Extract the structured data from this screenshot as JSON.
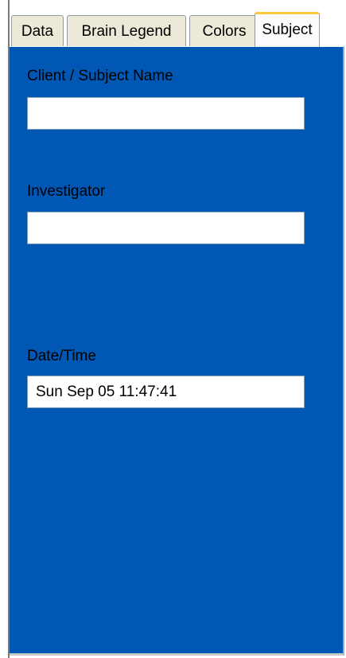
{
  "tabs": [
    {
      "label": "Data",
      "active": false
    },
    {
      "label": "Brain Legend",
      "active": false
    },
    {
      "label": "Colors",
      "active": false
    },
    {
      "label": "Subject",
      "active": true
    }
  ],
  "colors": {
    "panel_background": "#0058b4",
    "active_tab_highlight": "#ffc83c",
    "tab_background": "#ece9d8"
  },
  "fields": {
    "client_name": {
      "label": "Client / Subject Name",
      "value": ""
    },
    "investigator": {
      "label": "Investigator",
      "value": ""
    },
    "date_time": {
      "label": "Date/Time",
      "value": "Sun Sep 05 11:47:41"
    }
  }
}
